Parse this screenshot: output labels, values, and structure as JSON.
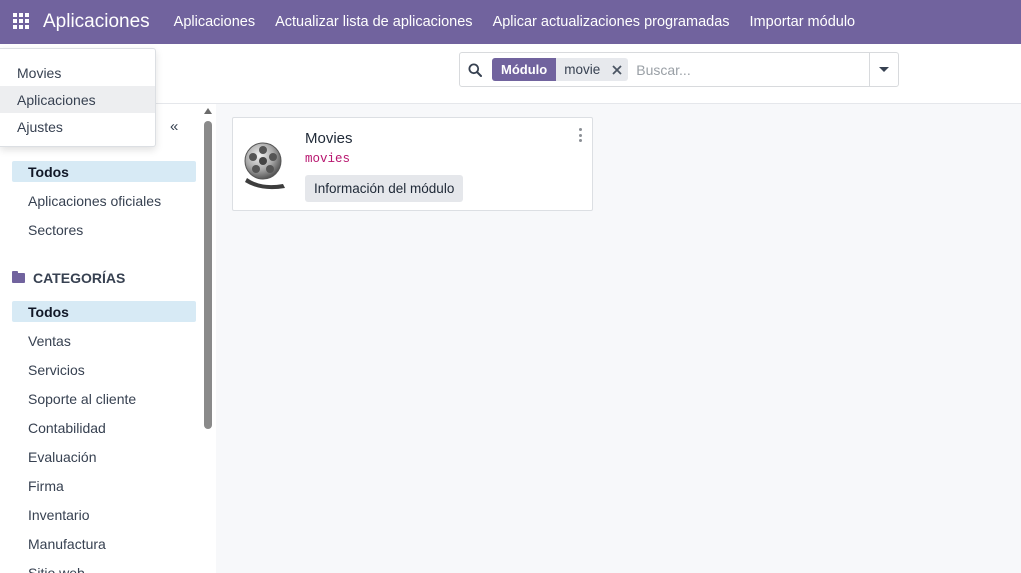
{
  "navbar": {
    "brand": "Aplicaciones",
    "menu": [
      "Aplicaciones",
      "Actualizar lista de aplicaciones",
      "Aplicar actualizaciones programadas",
      "Importar módulo"
    ]
  },
  "dropdown": {
    "items": [
      "Movies",
      "Aplicaciones",
      "Ajustes"
    ],
    "highlighted": "Aplicaciones"
  },
  "search": {
    "facet_label": "Módulo",
    "facet_value": "movie",
    "placeholder": "Buscar..."
  },
  "sidebar": {
    "collapse_glyph": "«",
    "filter_items": [
      "Todos",
      "Aplicaciones oficiales",
      "Sectores"
    ],
    "categories_title": "CATEGORÍAS",
    "category_items": [
      "Todos",
      "Ventas",
      "Servicios",
      "Soporte al cliente",
      "Contabilidad",
      "Evaluación",
      "Firma",
      "Inventario",
      "Manufactura",
      "Sitio web"
    ]
  },
  "modules": [
    {
      "name": "Movies",
      "technical_name": "movies",
      "info_button": "Información del módulo"
    }
  ],
  "colors": {
    "brand": "#71639e",
    "active_filter_bg": "#d7eaf5",
    "technical_name": "#b8166f"
  }
}
